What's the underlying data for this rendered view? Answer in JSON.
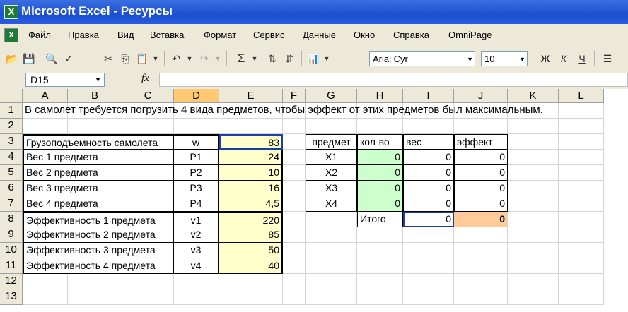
{
  "window": {
    "title": "Microsoft Excel - Ресурсы"
  },
  "menu": [
    "Файл",
    "Правка",
    "Вид",
    "Вставка",
    "Формат",
    "Сервис",
    "Данные",
    "Окно",
    "Справка",
    "OmniPage"
  ],
  "toolbar": {
    "font_name": "Arial Cyr",
    "font_size": "10",
    "bold": "Ж",
    "italic": "К",
    "underline": "Ч",
    "sum": "Σ"
  },
  "formula_bar": {
    "name_box": "D15",
    "fx": "fx",
    "formula": ""
  },
  "columns": [
    "A",
    "B",
    "C",
    "D",
    "E",
    "F",
    "G",
    "H",
    "I",
    "J",
    "K",
    "L"
  ],
  "rows": [
    "1",
    "2",
    "3",
    "4",
    "5",
    "6",
    "7",
    "8",
    "9",
    "10",
    "11",
    "12",
    "13"
  ],
  "sheet": {
    "A1": "В самолет требуется погрузить 4 вида предметов, чтобы эффект от этих предметов  был максимальным.",
    "A3": "Грузоподъемность самолета",
    "D3": "w",
    "E3": "83",
    "A4": "Вес 1 предмета",
    "D4": "P1",
    "E4": "24",
    "A5": "Вес 2 предмета",
    "D5": "P2",
    "E5": "10",
    "A6": "Вес 3 предмета",
    "D6": "P3",
    "E6": "16",
    "A7": "Вес 4 предмета",
    "D7": "P4",
    "E7": "4,5",
    "A8": "Эффективность 1 предмета",
    "D8": "v1",
    "E8": "220",
    "A9": "Эффективность 2 предмета",
    "D9": "v2",
    "E9": "85",
    "A10": "Эффективность 3 предмета",
    "D10": "v3",
    "E10": "50",
    "A11": "Эффективность 4 предмета",
    "D11": "v4",
    "E11": "40",
    "G3": "предмет",
    "H3": "кол-во",
    "I3": "вес",
    "J3": "эффект",
    "G4": "X1",
    "H4": "0",
    "I4": "0",
    "J4": "0",
    "G5": "X2",
    "H5": "0",
    "I5": "0",
    "J5": "0",
    "G6": "X3",
    "H6": "0",
    "I6": "0",
    "J6": "0",
    "G7": "X4",
    "H7": "0",
    "I7": "0",
    "J7": "0",
    "H8": "Итого",
    "I8": "0",
    "J8": "0"
  },
  "colors": {
    "title_bar": "#1c4fd0",
    "input_yellow": "#ffffcc",
    "var_green": "#ccffcc",
    "result_orange": "#ffcc99",
    "selection": "#1a3ea8"
  }
}
